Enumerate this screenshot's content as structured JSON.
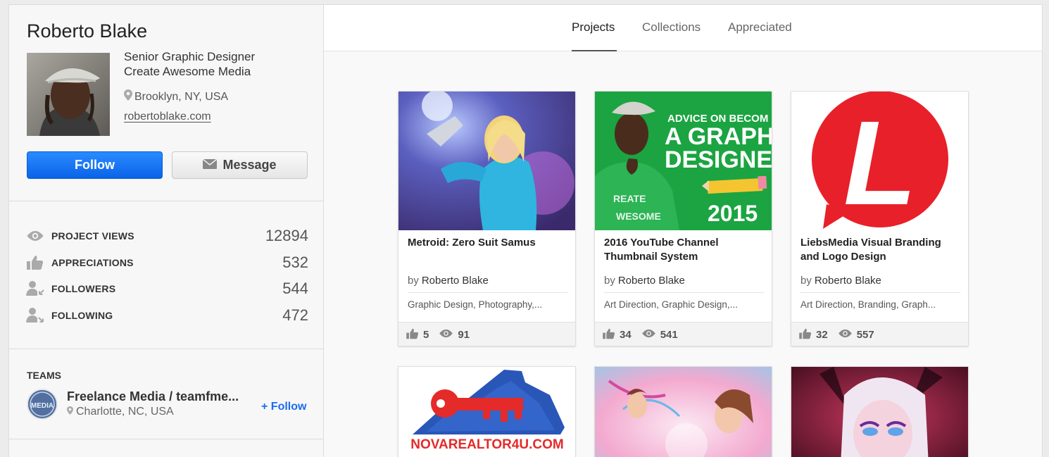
{
  "profile": {
    "name": "Roberto Blake",
    "bio_line1": "Senior Graphic Designer",
    "bio_line2": "Create Awesome Media",
    "location": "Brooklyn, NY, USA",
    "website": "robertoblake.com",
    "follow_label": "Follow",
    "message_label": "Message"
  },
  "stats": [
    {
      "label": "PROJECT VIEWS",
      "value": "12894",
      "icon": "eye-icon"
    },
    {
      "label": "APPRECIATIONS",
      "value": "532",
      "icon": "thumbs-up-icon"
    },
    {
      "label": "FOLLOWERS",
      "value": "544",
      "icon": "followers-icon"
    },
    {
      "label": "FOLLOWING",
      "value": "472",
      "icon": "following-icon"
    }
  ],
  "teams": {
    "heading": "TEAMS",
    "items": [
      {
        "name": "Freelance Media / teamfme...",
        "location": "Charlotte, NC, USA",
        "follow_label": "+ Follow",
        "logo_text": "MEDIA"
      }
    ]
  },
  "tabs": [
    {
      "label": "Projects",
      "active": true
    },
    {
      "label": "Collections",
      "active": false
    },
    {
      "label": "Appreciated",
      "active": false
    }
  ],
  "projects": [
    {
      "title": "Metroid: Zero Suit Samus",
      "by": "by",
      "author": "Roberto Blake",
      "fields": [
        "Graphic Design",
        "Photography,..."
      ],
      "appreciations": "5",
      "views": "91"
    },
    {
      "title": "2016 YouTube Channel Thumbnail System",
      "by": "by",
      "author": "Roberto Blake",
      "fields": [
        "Art Direction",
        "Graphic Design,..."
      ],
      "appreciations": "34",
      "views": "541",
      "thumb_text": {
        "line1": "ADVICE ON BECOM",
        "line2": "A GRAPH",
        "line3": "DESIGNE",
        "year": "2015",
        "shirt1": "REATE",
        "shirt2": "WESOME"
      }
    },
    {
      "title": "LiebsMedia Visual Branding and Logo Design",
      "by": "by",
      "author": "Roberto Blake",
      "fields": [
        "Art Direction",
        "Branding",
        "Graph..."
      ],
      "appreciations": "32",
      "views": "557",
      "thumb_text": {
        "letter": "L"
      }
    }
  ],
  "row2": [
    {
      "thumb_text": "NOVAREALTOR4U.COM"
    },
    {},
    {}
  ],
  "colors": {
    "accent": "#1a6cf0",
    "follow_button": "#1976f2",
    "liebs_red": "#e8202a",
    "youtube_green": "#1aa043"
  }
}
